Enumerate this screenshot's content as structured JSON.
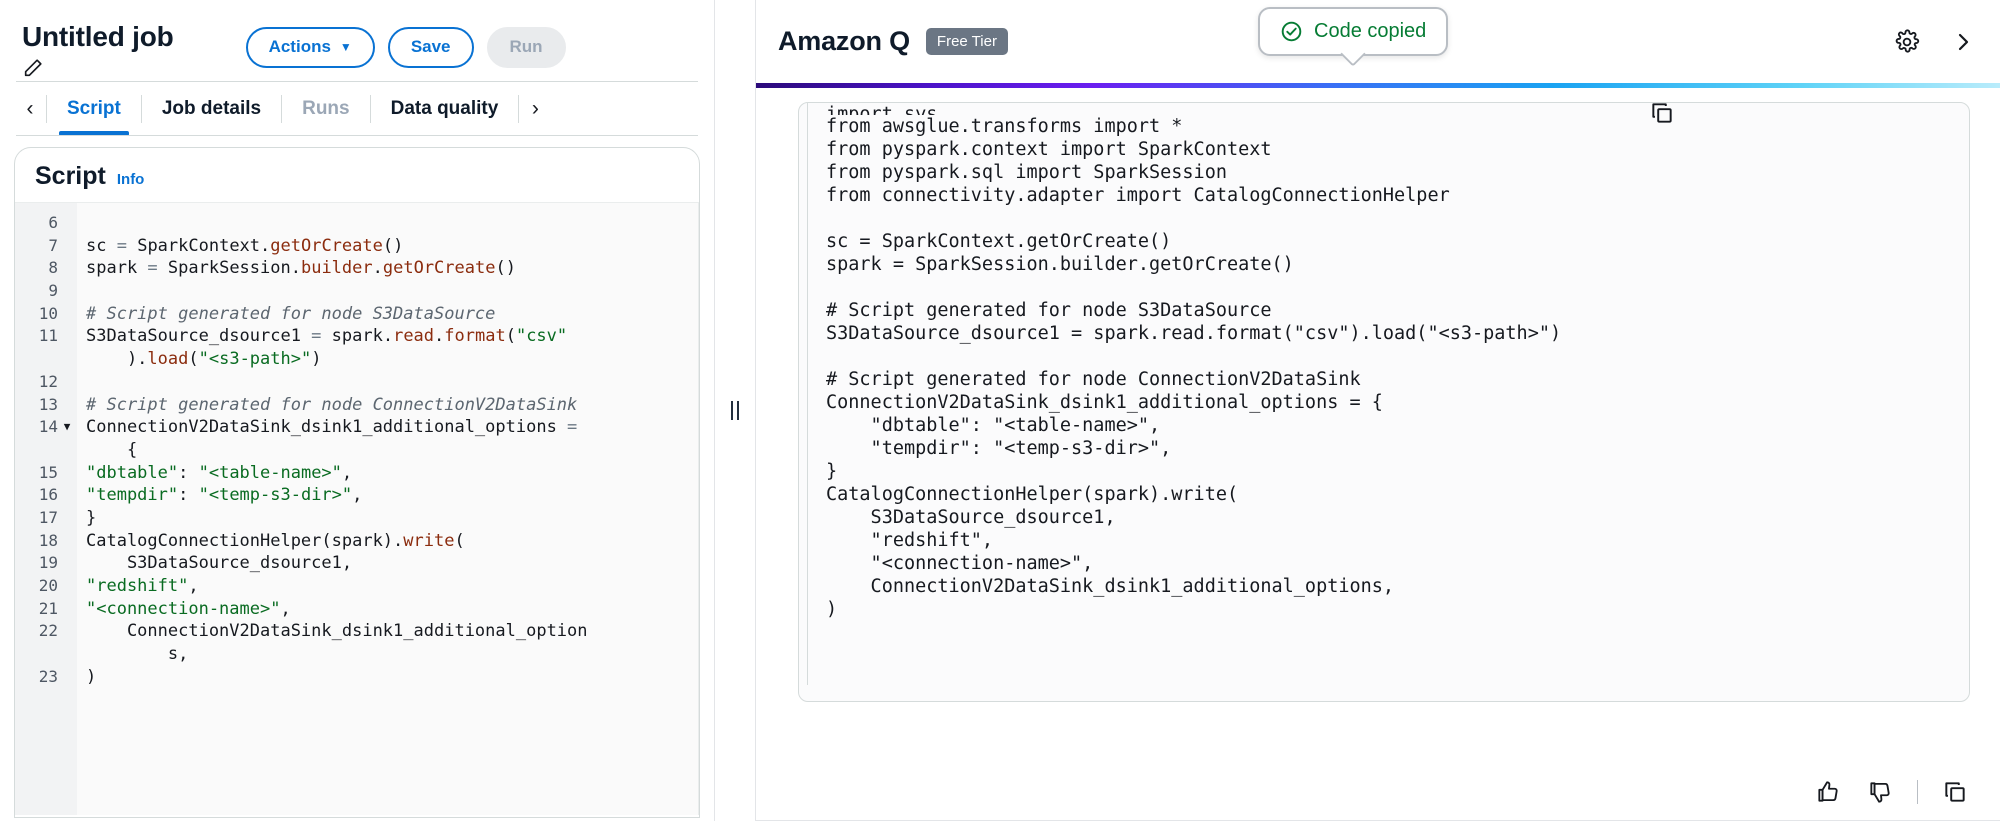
{
  "job": {
    "title": "Untitled job",
    "edit_icon": "pencil-icon",
    "actions_label": "Actions",
    "actions_caret": "▼",
    "save_label": "Save",
    "run_label": "Run"
  },
  "tabs": {
    "prev_arrow": "‹",
    "next_arrow": "›",
    "items": [
      {
        "label": "Script",
        "state": "active"
      },
      {
        "label": "Job details",
        "state": "normal"
      },
      {
        "label": "Runs",
        "state": "disabled"
      },
      {
        "label": "Data quality",
        "state": "normal"
      }
    ]
  },
  "script_panel": {
    "title": "Script",
    "info_label": "Info",
    "lines": [
      {
        "num": "6",
        "fold": "",
        "text": ""
      },
      {
        "num": "7",
        "fold": "",
        "text": "sc = SparkContext.getOrCreate()"
      },
      {
        "num": "8",
        "fold": "",
        "text": "spark = SparkSession.builder.getOrCreate()"
      },
      {
        "num": "9",
        "fold": "",
        "text": ""
      },
      {
        "num": "10",
        "fold": "",
        "text": "# Script generated for node S3DataSource"
      },
      {
        "num": "11",
        "fold": "",
        "text": "S3DataSource_dsource1 = spark.read.format(\"csv\""
      },
      {
        "num": "",
        "fold": "",
        "text": "    ).load(\"<s3-path>\")"
      },
      {
        "num": "12",
        "fold": "",
        "text": ""
      },
      {
        "num": "13",
        "fold": "",
        "text": "# Script generated for node ConnectionV2DataSink"
      },
      {
        "num": "14",
        "fold": "▼",
        "text": "ConnectionV2DataSink_dsink1_additional_options ="
      },
      {
        "num": "",
        "fold": "",
        "text": "    {"
      },
      {
        "num": "15",
        "fold": "",
        "text": "    \"dbtable\": \"<table-name>\","
      },
      {
        "num": "16",
        "fold": "",
        "text": "    \"tempdir\": \"<temp-s3-dir>\","
      },
      {
        "num": "17",
        "fold": "",
        "text": "}"
      },
      {
        "num": "18",
        "fold": "",
        "text": "CatalogConnectionHelper(spark).write("
      },
      {
        "num": "19",
        "fold": "",
        "text": "    S3DataSource_dsource1,"
      },
      {
        "num": "20",
        "fold": "",
        "text": "    \"redshift\","
      },
      {
        "num": "21",
        "fold": "",
        "text": "    \"<connection-name>\","
      },
      {
        "num": "22",
        "fold": "",
        "text": "    ConnectionV2DataSink_dsink1_additional_option"
      },
      {
        "num": "",
        "fold": "",
        "text": "        s,"
      },
      {
        "num": "23",
        "fold": "",
        "text": ")"
      }
    ]
  },
  "splitter": {
    "name": "pane-resize-handle"
  },
  "amazon_q": {
    "title": "Amazon Q",
    "badge": "Free Tier",
    "settings_icon": "gear-icon",
    "collapse_icon": "chevron-right-icon",
    "toast": {
      "text": "Code copied",
      "icon": "check-circle-icon",
      "color": "#067c34"
    },
    "code_copy_icon": "copy-icon",
    "code_lines": [
      "import sys",
      "from awsglue.transforms import *",
      "from pyspark.context import SparkContext",
      "from pyspark.sql import SparkSession",
      "from connectivity.adapter import CatalogConnectionHelper",
      "",
      "sc = SparkContext.getOrCreate()",
      "spark = SparkSession.builder.getOrCreate()",
      "",
      "# Script generated for node S3DataSource",
      "S3DataSource_dsource1 = spark.read.format(\"csv\").load(\"<s3-path>\")",
      "",
      "# Script generated for node ConnectionV2DataSink",
      "ConnectionV2DataSink_dsink1_additional_options = {",
      "    \"dbtable\": \"<table-name>\",",
      "    \"tempdir\": \"<temp-s3-dir>\",",
      "}",
      "CatalogConnectionHelper(spark).write(",
      "    S3DataSource_dsource1,",
      "    \"redshift\",",
      "    \"<connection-name>\",",
      "    ConnectionV2DataSink_dsink1_additional_options,",
      ")"
    ],
    "footer_actions": [
      {
        "icon": "thumbs-up-icon",
        "name": "thumbs-up-button"
      },
      {
        "icon": "thumbs-down-icon",
        "name": "thumbs-down-button"
      },
      {
        "icon": "copy-icon",
        "name": "copy-response-button"
      }
    ]
  },
  "colors": {
    "accent": "#0972d3",
    "success": "#067c34",
    "badge_bg": "#6b7684",
    "border": "#d5dbdb"
  }
}
